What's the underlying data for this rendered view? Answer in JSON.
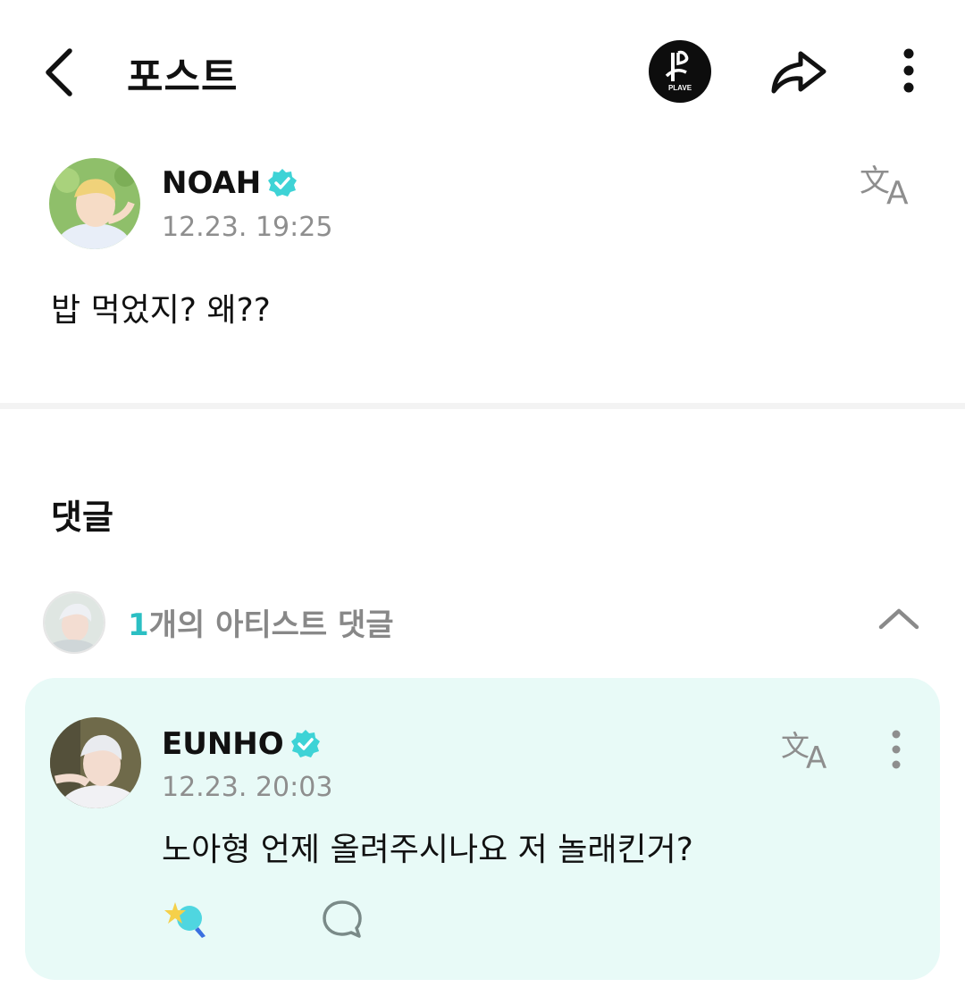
{
  "header": {
    "title": "포스트",
    "channel_logo_text": "PLAVE"
  },
  "post": {
    "author": "NOAH",
    "timestamp": "12.23. 19:25",
    "body": "밥 먹었지? 왜??"
  },
  "comments_section": {
    "heading": "댓글",
    "artist_comments": {
      "count": "1",
      "label": "개의 아티스트 댓글"
    }
  },
  "comment": {
    "author": "EUNHO",
    "timestamp": "12.23. 20:03",
    "body": "노아형 언제 올려주시나요 저 놀래킨거?"
  },
  "colors": {
    "accent": "#2bbfc3",
    "verified": "#3ed3d6",
    "card_bg": "#e8faf7",
    "muted_text": "#8e8e8e"
  }
}
